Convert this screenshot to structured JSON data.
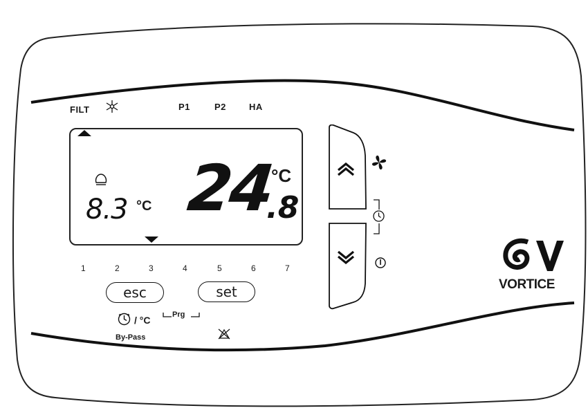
{
  "top_labels": {
    "filt": "FILT",
    "p1": "P1",
    "p2": "P2",
    "ha": "HA"
  },
  "display": {
    "main_value": "24",
    "main_decimal": ".8",
    "main_unit": "°C",
    "secondary_value": "8.3",
    "secondary_unit": "°C"
  },
  "numbers": [
    "1",
    "2",
    "3",
    "4",
    "5",
    "6",
    "7"
  ],
  "buttons": {
    "esc": "esc",
    "set": "set"
  },
  "bottom": {
    "timer_unit": "/ °C",
    "bypass": "By-Pass",
    "prg": "Prg"
  },
  "brand": {
    "name": "VORTICE"
  },
  "icons": {
    "snowflake": "snowflake-icon",
    "fan": "fan-icon",
    "clock": "clock-icon",
    "power": "power-icon",
    "alarm": "alarm-off-icon",
    "thermometer": "bulb-icon"
  }
}
